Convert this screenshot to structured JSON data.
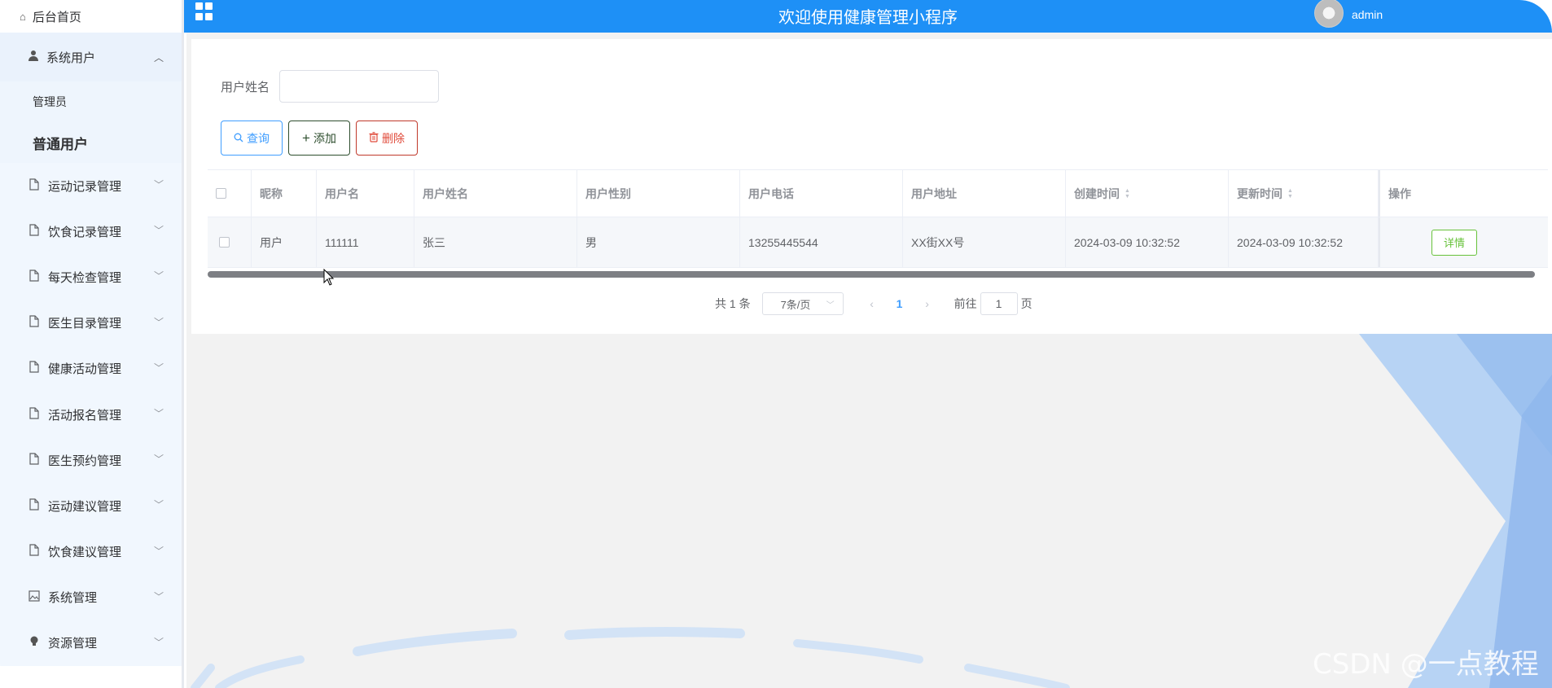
{
  "header": {
    "title": "欢迎使用健康管理小程序",
    "username": "admin"
  },
  "sidebar": {
    "home": "后台首页",
    "root": {
      "label": "系统用户",
      "children": [
        "管理员",
        "普通用户"
      ]
    },
    "items": [
      {
        "label": "运动记录管理",
        "icon": "file-icon"
      },
      {
        "label": "饮食记录管理",
        "icon": "file-icon"
      },
      {
        "label": "每天检查管理",
        "icon": "file-icon"
      },
      {
        "label": "医生目录管理",
        "icon": "file-icon"
      },
      {
        "label": "健康活动管理",
        "icon": "file-icon"
      },
      {
        "label": "活动报名管理",
        "icon": "file-icon"
      },
      {
        "label": "医生预约管理",
        "icon": "file-icon"
      },
      {
        "label": "运动建议管理",
        "icon": "file-icon"
      },
      {
        "label": "饮食建议管理",
        "icon": "file-icon"
      },
      {
        "label": "系统管理",
        "icon": "picture-icon"
      },
      {
        "label": "资源管理",
        "icon": "bulb-icon"
      }
    ]
  },
  "search": {
    "label": "用户姓名",
    "value": "",
    "placeholder": ""
  },
  "toolbar": {
    "query": "查询",
    "add": "添加",
    "delete": "删除"
  },
  "table": {
    "columns": [
      "昵称",
      "用户名",
      "用户姓名",
      "用户性别",
      "用户电话",
      "用户地址",
      "创建时间",
      "更新时间",
      "操作"
    ],
    "rows": [
      [
        "用户",
        "111111",
        "张三",
        "男",
        "13255445544",
        "XX街XX号",
        "2024-03-09 10:32:52",
        "2024-03-09 10:32:52",
        "详情"
      ]
    ]
  },
  "pagination": {
    "total": "共 1 条",
    "page_size": "7条/页",
    "current": "1",
    "goto_label": "前往",
    "goto_value": "1",
    "page_suffix": "页"
  },
  "watermark": "CSDN @一点教程",
  "colors": {
    "header_bg": "#1e90f6",
    "primary": "#409eff",
    "success": "#67c23a",
    "danger": "#e04a3a"
  }
}
